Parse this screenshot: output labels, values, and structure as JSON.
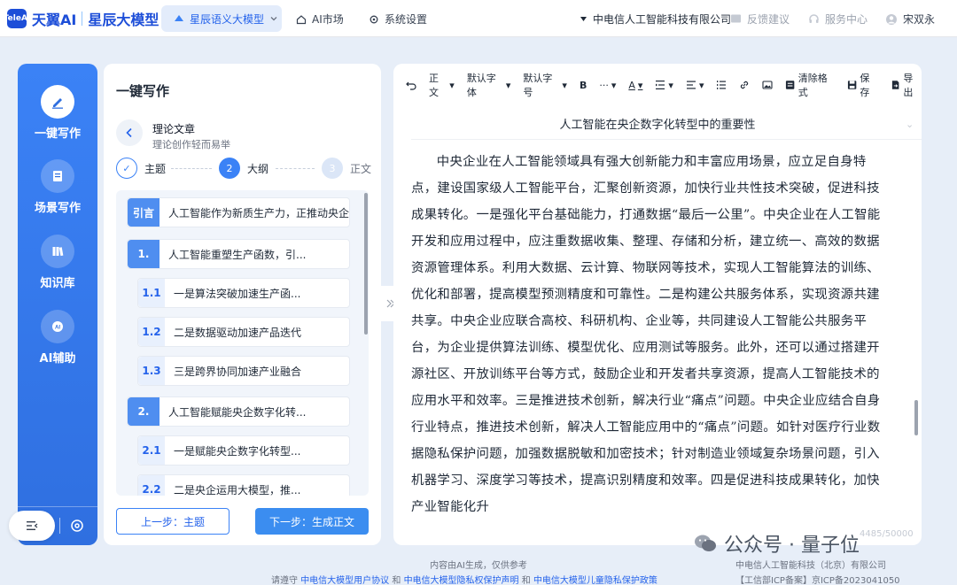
{
  "colors": {
    "accent": "#2563eb",
    "sidebar": "#3b82f6",
    "next_button": "#3b8df0"
  },
  "header": {
    "logo_badge": "TeleAI",
    "brand": "天翼AI",
    "product": "星辰大模型",
    "nav_model": "星辰语义大模型",
    "nav_market": "AI市场",
    "nav_settings": "系统设置",
    "org": "中电信人工智能科技有限公司",
    "feedback": "反馈建议",
    "service": "服务中心",
    "user": "宋双永"
  },
  "sidebar": {
    "items": [
      {
        "label": "一键写作",
        "icon": "pen-icon"
      },
      {
        "label": "场景写作",
        "icon": "document-icon"
      },
      {
        "label": "知识库",
        "icon": "books-icon"
      },
      {
        "label": "AI辅助",
        "icon": "ai-icon"
      }
    ]
  },
  "panel": {
    "title": "一键写作",
    "category": "理论文章",
    "category_desc": "理论创作轻而易举",
    "steps": [
      {
        "num": "✓",
        "label": "主题"
      },
      {
        "num": "2",
        "label": "大纲"
      },
      {
        "num": "3",
        "label": "正文"
      }
    ],
    "outline": [
      {
        "tag": "引言",
        "text": "人工智能作为新质生产力，正推动央企"
      },
      {
        "tag": "1.",
        "text": "人工智能重塑生产函数，引..."
      },
      {
        "tag": "1.1",
        "text": "一是算法突破加速生产函..."
      },
      {
        "tag": "1.2",
        "text": "二是数据驱动加速产品迭代"
      },
      {
        "tag": "1.3",
        "text": "三是跨界协同加速产业融合"
      },
      {
        "tag": "2.",
        "text": "人工智能赋能央企数字化转..."
      },
      {
        "tag": "2.1",
        "text": "一是赋能央企数字化转型..."
      },
      {
        "tag": "2.2",
        "text": "二是央企运用大模型，推..."
      }
    ],
    "prev_label": "上一步：主题",
    "next_label": "下一步：生成正文"
  },
  "editor": {
    "toolbar": {
      "paragraph": "正文",
      "font": "默认字体",
      "size": "默认字号",
      "bold": "B",
      "more": "···",
      "font_color": "A",
      "clear": "清除格式",
      "save": "保存",
      "export": "导出"
    },
    "title": "人工智能在央企数字化转型中的重要性",
    "body": "中央企业在人工智能领域具有强大创新能力和丰富应用场景，应立足自身特点，建设国家级人工智能平台，汇聚创新资源，加快行业共性技术突破，促进科技成果转化。一是强化平台基础能力，打通数据“最后一公里”。中央企业在人工智能开发和应用过程中，应注重数据收集、整理、存储和分析，建立统一、高效的数据资源管理体系。利用大数据、云计算、物联网等技术，实现人工智能算法的训练、优化和部署，提高模型预测精度和可靠性。二是构建公共服务体系，实现资源共建共享。中央企业应联合高校、科研机构、企业等，共同建设人工智能公共服务平台，为企业提供算法训练、模型优化、应用测试等服务。此外，还可以通过搭建开源社区、开放训练平台等方式，鼓励企业和开发者共享资源，提高人工智能技术的应用水平和效率。三是推进技术创新，解决行业“痛点”问题。中央企业应结合自身行业特点，推进技术创新，解决人工智能应用中的“痛点”问题。如针对医疗行业数据隐私保护问题，加强数据脱敏和加密技术；针对制造业领域复杂场景问题，引入机器学习、深度学习等技术，提高识别精度和效率。四是促进科技成果转化，加快产业智能化升",
    "counter": "4485/50000"
  },
  "footer": {
    "ai_notice": "内容由AI生成，仅供参考",
    "agree_prefix": "请遵守",
    "link1": "中电信大模型用户协议",
    "and1": "和",
    "link2": "中电信大模型隐私权保护声明",
    "and2": "和",
    "link3": "中电信大模型儿童隐私保护政策",
    "company": "中电信人工智能科技（北京）有限公司",
    "icp": "【工信部ICP备案】京ICP备2023041050"
  },
  "watermark": "公众号 · 量子位"
}
